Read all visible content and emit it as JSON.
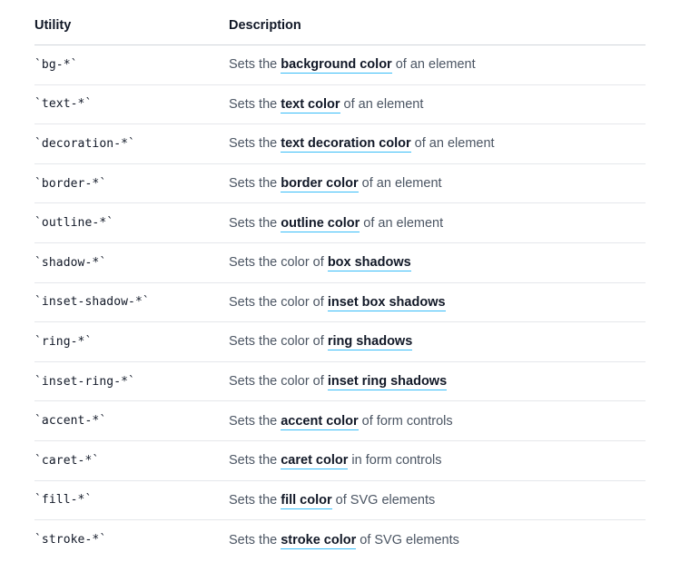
{
  "table": {
    "headers": {
      "utility": "Utility",
      "description": "Description"
    },
    "rows": [
      {
        "utility": "`bg-*`",
        "before": "Sets the ",
        "link": "background color",
        "after": " of an element"
      },
      {
        "utility": "`text-*`",
        "before": "Sets the ",
        "link": "text color",
        "after": " of an element"
      },
      {
        "utility": "`decoration-*`",
        "before": "Sets the ",
        "link": "text decoration color",
        "after": " of an element"
      },
      {
        "utility": "`border-*`",
        "before": "Sets the ",
        "link": "border color",
        "after": " of an element"
      },
      {
        "utility": "`outline-*`",
        "before": "Sets the ",
        "link": "outline color",
        "after": " of an element"
      },
      {
        "utility": "`shadow-*`",
        "before": "Sets the color of ",
        "link": "box shadows",
        "after": ""
      },
      {
        "utility": "`inset-shadow-*`",
        "before": "Sets the color of ",
        "link": "inset box shadows",
        "after": ""
      },
      {
        "utility": "`ring-*`",
        "before": "Sets the color of ",
        "link": "ring shadows",
        "after": ""
      },
      {
        "utility": "`inset-ring-*`",
        "before": "Sets the color of ",
        "link": "inset ring shadows",
        "after": ""
      },
      {
        "utility": "`accent-*`",
        "before": "Sets the ",
        "link": "accent color",
        "after": " of form controls"
      },
      {
        "utility": "`caret-*`",
        "before": "Sets the ",
        "link": "caret color",
        "after": " in form controls"
      },
      {
        "utility": "`fill-*`",
        "before": "Sets the ",
        "link": "fill color",
        "after": " of SVG elements"
      },
      {
        "utility": "`stroke-*`",
        "before": "Sets the ",
        "link": "stroke color",
        "after": " of SVG elements"
      }
    ]
  },
  "colors": {
    "link_underline": "#38bdf8",
    "divider": "#e5e7eb",
    "heading_text": "#111827",
    "body_text": "#4b5563"
  }
}
